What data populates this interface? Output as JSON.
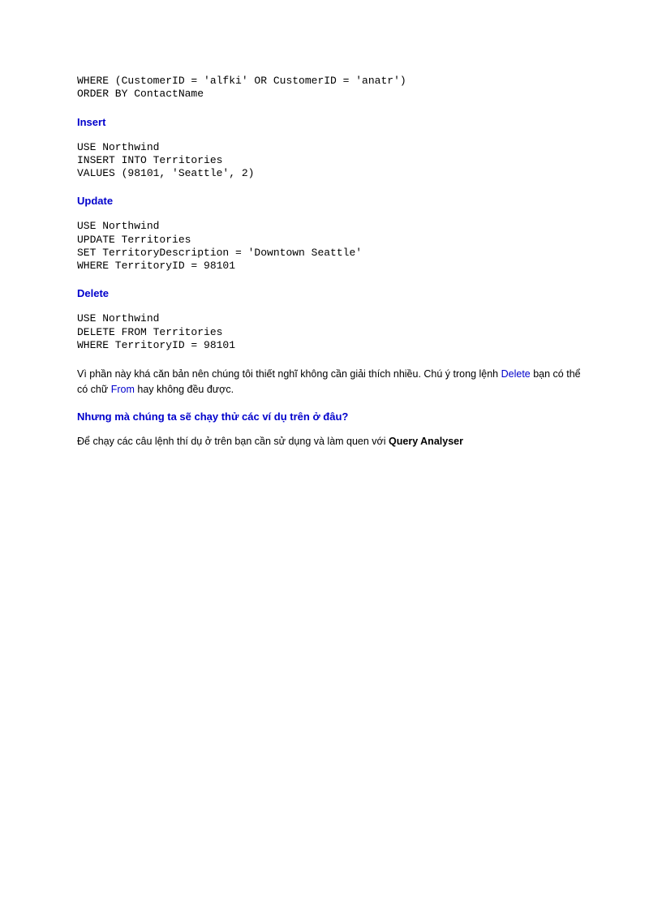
{
  "code_fragment": "WHERE (CustomerID = 'alfki' OR CustomerID = 'anatr')\nORDER BY ContactName",
  "sections": {
    "insert": {
      "heading": "Insert",
      "code": "USE Northwind\nINSERT INTO Territories\nVALUES (98101, 'Seattle', 2)"
    },
    "update": {
      "heading": "Update",
      "code": "USE Northwind\nUPDATE Territories\nSET TerritoryDescription = 'Downtown Seattle'\nWHERE TerritoryID = 98101"
    },
    "delete": {
      "heading": "Delete",
      "code": "USE Northwind\nDELETE FROM Territories\nWHERE TerritoryID = 98101"
    }
  },
  "paragraph1": {
    "pre": "Vì phần này khá căn bản nên chúng tôi thiết nghĩ không cần giải thích nhiều. Chú ý trong lệnh ",
    "kw1": "Delete",
    "mid": " bạn có thể có chữ ",
    "kw2": "From",
    "post": " hay không đều được."
  },
  "question": "Nhưng mà chúng ta sẽ chạy thử các ví dụ trên ở đâu?",
  "paragraph2": {
    "pre": "Ðể chạy các câu lệnh thí dụ ở trên bạn cần sử dụng và làm quen với ",
    "bold": "Query Analyser"
  }
}
